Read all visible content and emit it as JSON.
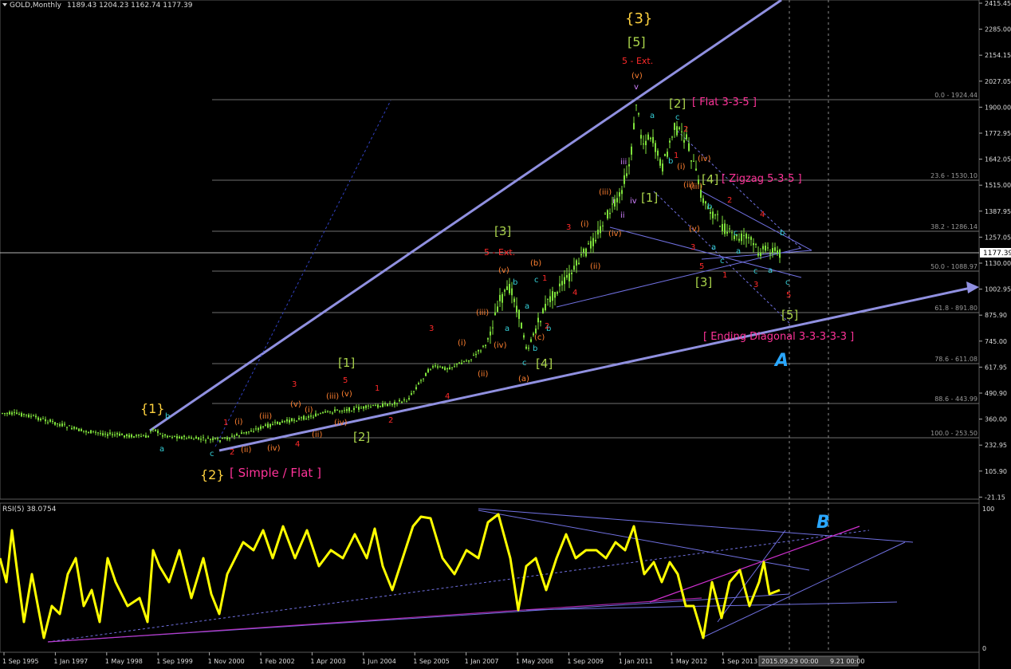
{
  "header": {
    "symbol": "GOLD,Monthly",
    "ohlc": "1189.43 1204.23 1162.74 1177.39"
  },
  "price_axis": {
    "ticks": [
      "2415.45",
      "2285.00",
      "2154.15",
      "2027.05",
      "1900.00",
      "1772.95",
      "1642.05",
      "1515.00",
      "1387.95",
      "1257.05",
      "1130.00",
      "1002.95",
      "875.90",
      "745.00",
      "617.95",
      "490.90",
      "360.00",
      "232.95",
      "105.90",
      "-21.15"
    ],
    "current": "1177.39"
  },
  "rsi_header": "RSI(5) 38.0754",
  "rsi_axis": [
    "100",
    "0"
  ],
  "time_axis": [
    "1 Sep 1995",
    "1 Jan 1997",
    "1 May 1998",
    "1 Sep 1999",
    "1 Nov 2000",
    "1 Feb 2002",
    "1 Apr 2003",
    "1 Jun 2004",
    "1 Sep 2005",
    "1 Jan 2007",
    "1 May 2008",
    "1 Sep 2009",
    "1 Jan 2011",
    "1 May 2012",
    "1 Sep 2013"
  ],
  "time_readout": [
    "2015.09.29 00:00",
    "9.21 00:00"
  ],
  "fib_levels": [
    "0.0 - 1924.44",
    "23.6 - 1530.10",
    "38.2 - 1286.14",
    "50.0 - 1088.97",
    "61.8 - 891.80",
    "78.6 - 611.08",
    "88.6 - 443.99",
    "100.0 - 253.50"
  ],
  "colors": {
    "candle": "#7fe23c",
    "rsi": "#ffff00",
    "trend": "#8c8ce0",
    "fib": "#6f6f6f",
    "wave_major": "#ffd23f",
    "wave_green": "#a8d24a",
    "wave_red": "#ff2a2a",
    "wave_orange": "#ff8030",
    "wave_cyan": "#35d0d8",
    "wave_pink": "#ff3399",
    "wave_magenta": "#d080ff"
  },
  "annotations": {
    "w1_major": "{1}",
    "w2_major": "{2}",
    "w2_title": "[ Simple / Flat ]",
    "w3_major": "{3}",
    "w5_bracket": "[5]",
    "ext_top": "5 - Ext.",
    "w1_bracket": "[1]",
    "w2_bracket": "[2]",
    "w3_bracket": "[3]",
    "w3_ext": "5 - Ext.",
    "w4_bracket": "[4]",
    "b1_bracket": "[1]",
    "b2_bracket": "[2]",
    "flat_title": "[ Flat 3-3-5 ]",
    "b3_bracket": "[3]",
    "b4_bracket": "[4]",
    "zigzag_title": "[ Zigzag 5-3-5 ]",
    "b5_bracket": "[5]",
    "ending_title": "[ Ending Diagonal 3-3-3-3-3 ]",
    "sym_a": "A",
    "sym_b": "B",
    "small_labels": [
      "a",
      "b",
      "c",
      "1",
      "2",
      "3",
      "4",
      "5",
      "(i)",
      "(ii)",
      "(iii)",
      "(iv)",
      "(v)",
      "(a)",
      "(b)",
      "(c)",
      "i",
      "ii",
      "iii",
      "iv",
      "v"
    ]
  }
}
